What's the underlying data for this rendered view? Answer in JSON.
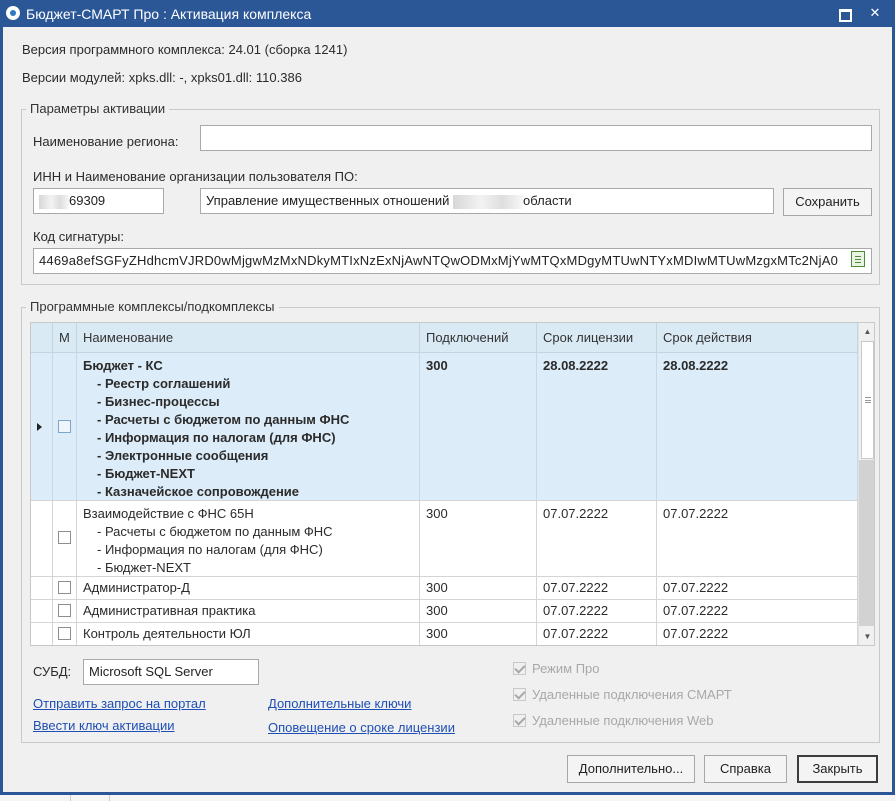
{
  "window": {
    "title": "Бюджет-СМАРТ Про : Активация комплекса",
    "maximize_icon": "maximize-icon",
    "close_label": "✕"
  },
  "info": {
    "version": "Версия программного комплекса: 24.01 (сборка 1241)",
    "modules": "Версии модулей: xpks.dll: -, xpks01.dll: 110.386"
  },
  "activation": {
    "group_title": "Параметры активации",
    "region_label": "Наименование региона:",
    "region_value": "",
    "org_label": "ИНН и Наименование организации пользователя ПО:",
    "inn_value": "69309",
    "org_value_start": "Управление имущественных отношений ",
    "org_value_end": "области",
    "save_button": "Сохранить",
    "signature_label": "Код сигнатуры:",
    "signature_value": "4469a8efSGFyZHdhcmVJRD0wMjgwMzMxNDkyMTIxNzExNjAwNTQwODMxMjYwMTQxMDgyMTUwNTYxMDIwMTUwMzgxMTc2NjA0",
    "copy_icon": "clipboard-copy-icon"
  },
  "complexes": {
    "group_title": "Программные комплексы/подкомплексы",
    "columns": [
      "М",
      "Наименование",
      "Подключений",
      "Срок лицензии",
      "Срок действия"
    ],
    "rows": [
      {
        "name": "Бюджет - КС",
        "subitems": [
          "- Реестр соглашений",
          "- Бизнес-процессы",
          "- Расчеты с бюджетом по данным ФНС",
          "- Информация по налогам (для ФНС)",
          "- Электронные сообщения",
          "- Бюджет-NEXT",
          "- Казначейское сопровождение"
        ],
        "connections": "300",
        "license": "28.08.2222",
        "validity": "28.08.2222",
        "selected": true
      },
      {
        "name": "Взаимодействие с ФНС 65Н",
        "subitems": [
          "- Расчеты с бюджетом по данным ФНС",
          "- Информация по налогам (для ФНС)",
          "- Бюджет-NEXT"
        ],
        "connections": "300",
        "license": "07.07.2222",
        "validity": "07.07.2222"
      },
      {
        "name": "Администратор-Д",
        "subitems": [],
        "connections": "300",
        "license": "07.07.2222",
        "validity": "07.07.2222"
      },
      {
        "name": "Административная практика",
        "subitems": [],
        "connections": "300",
        "license": "07.07.2222",
        "validity": "07.07.2222"
      },
      {
        "name": "Контроль деятельности ЮЛ",
        "subitems": [],
        "connections": "300",
        "license": "07.07.2222",
        "validity": "07.07.2222"
      }
    ]
  },
  "bottom": {
    "dbms_label": "СУБД:",
    "dbms_value": "Microsoft SQL Server",
    "links": {
      "send_request": "Отправить запрос на портал",
      "enter_key": "Ввести ключ активации",
      "additional_keys": "Дополнительные ключи",
      "license_notify": "Оповещение о сроке лицензии"
    },
    "checkboxes": [
      {
        "label": "Режим Про",
        "checked": true
      },
      {
        "label": "Удаленные подключения СМАРТ",
        "checked": true
      },
      {
        "label": "Удаленные подключения Web",
        "checked": true
      }
    ]
  },
  "buttons": {
    "more": "Дополнительно...",
    "help": "Справка",
    "close": "Закрыть"
  }
}
